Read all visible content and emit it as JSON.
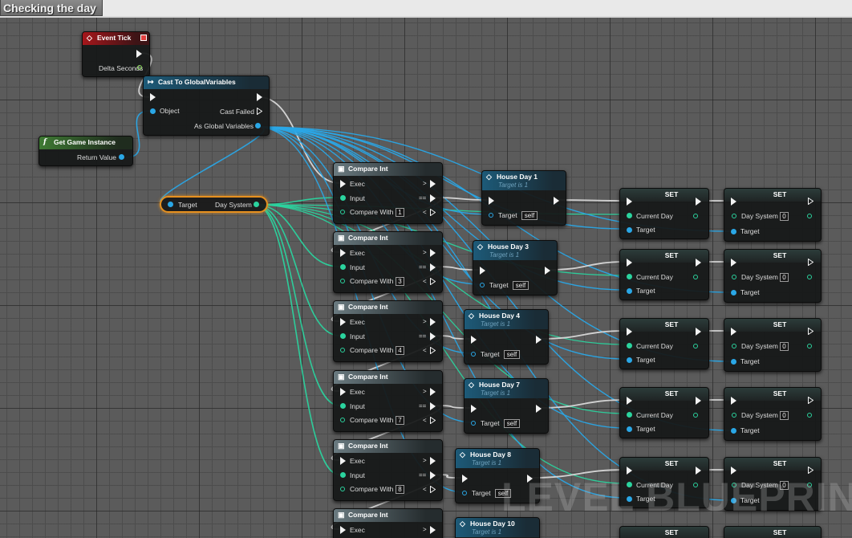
{
  "comment": {
    "title": "Checking the day"
  },
  "watermark": "LEVEL BLUEPRINT",
  "colors": {
    "exec": "#f2f2f2",
    "object_pin": "#2aa7e6",
    "int_pin": "#2bd39e",
    "event_header": "#a6161b",
    "cast_header": "#1d5a78",
    "function_header": "#3e7a33",
    "compare_header": "#6a7a80",
    "selection_outline": "#e6901f",
    "grid_bg": "#5b5b5b"
  },
  "event_tick": {
    "title": "Event Tick",
    "pin_delta": "Delta Seconds"
  },
  "cast": {
    "title": "Cast To GlobalVariables",
    "pin_object": "Object",
    "pin_failed": "Cast Failed",
    "pin_as": "As Global Variables"
  },
  "get_game_instance": {
    "title": "Get Game Instance",
    "pin_return": "Return Value"
  },
  "var_get": {
    "pin_target": "Target",
    "pin_out": "Day System"
  },
  "compare_nodes": [
    {
      "title": "Compare Int",
      "exec": "Exec",
      "input": "Input",
      "compare_with": "Compare With",
      "value": "1",
      "sym1": ">",
      "sym2": "==",
      "sym3": "<"
    },
    {
      "title": "Compare Int",
      "exec": "Exec",
      "input": "Input",
      "compare_with": "Compare With",
      "value": "3",
      "sym1": ">",
      "sym2": "==",
      "sym3": "<"
    },
    {
      "title": "Compare Int",
      "exec": "Exec",
      "input": "Input",
      "compare_with": "Compare With",
      "value": "4",
      "sym1": ">",
      "sym2": "==",
      "sym3": "<"
    },
    {
      "title": "Compare Int",
      "exec": "Exec",
      "input": "Input",
      "compare_with": "Compare With",
      "value": "7",
      "sym1": ">",
      "sym2": "==",
      "sym3": "<"
    },
    {
      "title": "Compare Int",
      "exec": "Exec",
      "input": "Input",
      "compare_with": "Compare With",
      "value": "8",
      "sym1": ">",
      "sym2": "==",
      "sym3": "<"
    },
    {
      "title": "Compare Int",
      "exec": "Exec",
      "input": "",
      "compare_with": "",
      "value": "",
      "sym1": ">",
      "sym2": "",
      "sym3": ""
    }
  ],
  "house_nodes": [
    {
      "title": "House Day 1",
      "subtitle": "Target is 1",
      "pin_target": "Target",
      "value": "self"
    },
    {
      "title": "House Day 3",
      "subtitle": "Target is 1",
      "pin_target": "Target",
      "value": "self"
    },
    {
      "title": "House Day 4",
      "subtitle": "Target is 1",
      "pin_target": "Target",
      "value": "self"
    },
    {
      "title": "House Day 7",
      "subtitle": "Target is 1",
      "pin_target": "Target",
      "value": "self"
    },
    {
      "title": "House Day 8",
      "subtitle": "Target is 1",
      "pin_target": "Target",
      "value": "self"
    },
    {
      "title": "House Day 10",
      "subtitle": "Target is 1",
      "pin_target": "",
      "value": ""
    }
  ],
  "set_current_nodes": [
    {
      "title": "SET",
      "pin_var": "Current Day",
      "pin_target": "Target"
    },
    {
      "title": "SET",
      "pin_var": "Current Day",
      "pin_target": "Target"
    },
    {
      "title": "SET",
      "pin_var": "Current Day",
      "pin_target": "Target"
    },
    {
      "title": "SET",
      "pin_var": "Current Day",
      "pin_target": "Target"
    },
    {
      "title": "SET",
      "pin_var": "Current Day",
      "pin_target": "Target"
    },
    {
      "title": "SET",
      "pin_var": "",
      "pin_target": ""
    }
  ],
  "set_system_nodes": [
    {
      "title": "SET",
      "pin_var": "Day System",
      "value": "0",
      "pin_target": "Target"
    },
    {
      "title": "SET",
      "pin_var": "Day System",
      "value": "0",
      "pin_target": "Target"
    },
    {
      "title": "SET",
      "pin_var": "Day System",
      "value": "0",
      "pin_target": "Target"
    },
    {
      "title": "SET",
      "pin_var": "Day System",
      "value": "0",
      "pin_target": "Target"
    },
    {
      "title": "SET",
      "pin_var": "Day System",
      "value": "0",
      "pin_target": "Target"
    },
    {
      "title": "SET",
      "pin_var": "",
      "value": "",
      "pin_target": ""
    }
  ]
}
